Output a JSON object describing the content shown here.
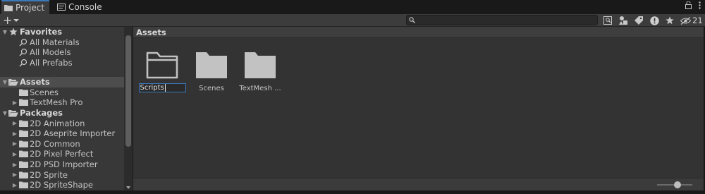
{
  "tabs": [
    {
      "label": "Project",
      "icon": "folder-icon",
      "active": true
    },
    {
      "label": "Console",
      "icon": "console-icon",
      "active": false
    }
  ],
  "toolbar": {
    "add_label": "+",
    "search_value": "",
    "hidden_count": "21",
    "icons": [
      "search-by-type-icon",
      "filter-by-type-icon",
      "filter-by-label-icon",
      "warning-icon",
      "favorites-icon",
      "hidden-packages-icon"
    ]
  },
  "tree": {
    "favorites": {
      "label": "Favorites",
      "items": [
        "All Materials",
        "All Models",
        "All Prefabs"
      ]
    },
    "assets": {
      "label": "Assets",
      "items": [
        "Scenes",
        "TextMesh Pro"
      ]
    },
    "packages": {
      "label": "Packages",
      "items": [
        "2D Animation",
        "2D Aseprite Importer",
        "2D Common",
        "2D Pixel Perfect",
        "2D PSD Importer",
        "2D Sprite",
        "2D SpriteShape"
      ]
    }
  },
  "content": {
    "breadcrumb": "Assets",
    "items": [
      {
        "label": "Scripts",
        "renaming": true
      },
      {
        "label": "Scenes",
        "renaming": false
      },
      {
        "label": "TextMesh ...",
        "renaming": false
      }
    ]
  },
  "zoom": {
    "value": 0.6
  },
  "colors": {
    "accent": "#3a79bb",
    "panel": "#383838",
    "content": "#333333",
    "folder": "#c2c2c2"
  }
}
